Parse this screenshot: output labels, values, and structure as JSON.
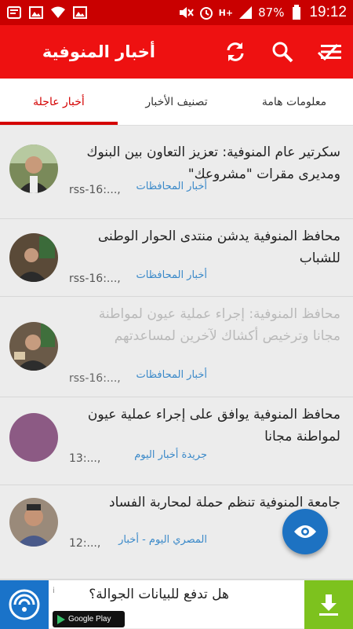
{
  "status_bar": {
    "battery": "87%",
    "time": "19:12",
    "network": "H+"
  },
  "app_bar": {
    "title": "أخبار المنوفية"
  },
  "tabs": [
    {
      "label": "معلومات هامة"
    },
    {
      "label": "تصنيف الأخبار"
    },
    {
      "label": "أخبار عاجلة"
    }
  ],
  "news": [
    {
      "headline": "سكرتير عام المنوفية: تعزيز التعاون بين البنوك ومديرى مقرات \"مشروعك\"",
      "source": "أخبار المحافظات",
      "time": "rss-16:..., ",
      "dimmed": false
    },
    {
      "headline": "محافظ المنوفية يدشن منتدى الحوار الوطنى للشباب",
      "source": "أخبار المحافظات",
      "time": "rss-16:..., ",
      "dimmed": false
    },
    {
      "headline": "محافظ المنوفية: إجراء عملية عيون لمواطنة مجانا وترخيص أكشاك لآخرين لمساعدتهم",
      "source": "أخبار المحافظات",
      "time": "rss-16:..., ",
      "dimmed": true
    },
    {
      "headline": "محافظ المنوفية يوافق على إجراء عملية عيون لمواطنة مجانا",
      "source": "جريدة أخبار اليوم",
      "time": "13:..., ",
      "dimmed": false
    },
    {
      "headline": "جامعة المنوفية تنظم حملة لمحاربة الفساد",
      "source": "المصري اليوم - أخبار",
      "time": "12:..., ",
      "dimmed": false
    }
  ],
  "ad": {
    "text": "هل تدفع للبيانات الجوالة؟",
    "store_label": "Google Play",
    "info": "i"
  },
  "colors": {
    "status_bar": "#c90000",
    "app_bar": "#ee1111",
    "accent": "#d40000",
    "link": "#3a89c9",
    "fab": "#1d72c2",
    "ad_download": "#7dc21e"
  }
}
